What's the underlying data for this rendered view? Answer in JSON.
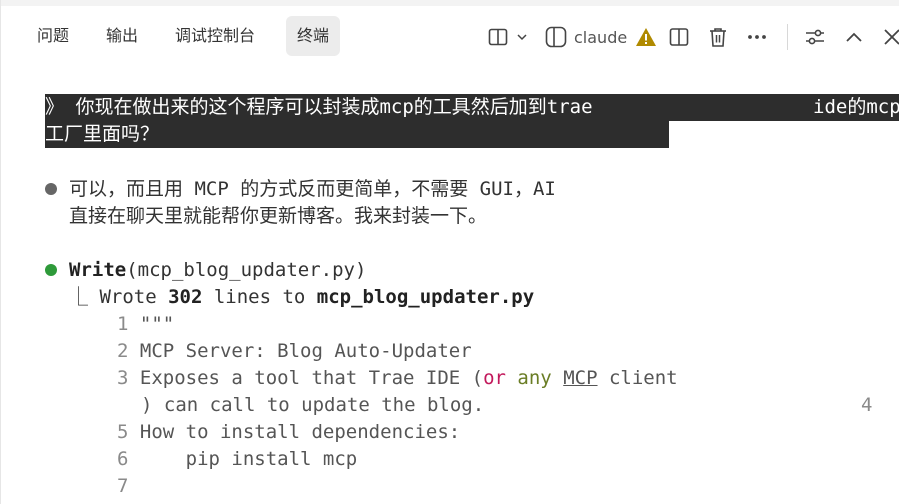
{
  "tabs": [
    {
      "label": "问题",
      "active": false
    },
    {
      "label": "输出",
      "active": false
    },
    {
      "label": "调试控制台",
      "active": false
    },
    {
      "label": "终端",
      "active": true
    }
  ],
  "toolbar": {
    "profile_label": "claude",
    "icons": [
      "split-layout-icon",
      "chevron-down-icon",
      "terminal-profile-icon",
      "warning-icon",
      "split-editor-icon",
      "trash-icon",
      "more-icon",
      "settings-sliders-icon",
      "chevron-up-icon",
      "close-icon"
    ],
    "warning_color": "#b08a00"
  },
  "terminal": {
    "prompt": {
      "marker": "》",
      "line1_a": "你现在做出来的这个程序可以封装成mcp的工具然后加到trae",
      "line1_b": "ide的mcp",
      "line2": "工厂里面吗？"
    },
    "reply": {
      "line1": "可以，而且用 MCP 的方式反而更简单，不需要 GUI，AI",
      "line2": "直接在聊天里就能帮你更新博客。我来封装一下。"
    },
    "tool_call": {
      "name": "Write",
      "arg": "(mcp_blog_updater.py)",
      "result_prefix": "⎿ Wrote ",
      "result_count": "302",
      "result_mid": " lines to ",
      "result_file": "mcp_blog_updater.py"
    },
    "code_lines": [
      {
        "num": "1",
        "text": "\"\"\""
      },
      {
        "num": "2",
        "text": "MCP Server: Blog Auto-Updater"
      },
      {
        "num": "3",
        "text_a": "Exposes a tool that Trae IDE (",
        "kw": "or",
        "sp": " ",
        "ident": "any",
        "sp2": " ",
        "ul": "MCP",
        "text_b": " client"
      },
      {
        "num": "",
        "text": ") can call to update the blog.",
        "trailing_num": "4"
      },
      {
        "num": "5",
        "text": "How to install dependencies:"
      },
      {
        "num": "6",
        "text": "    pip install mcp"
      },
      {
        "num": "7",
        "text": ""
      }
    ],
    "colors": {
      "success": "#2e9a3a",
      "prompt_bg": "#2d2d2d",
      "keyword": "#c2185b",
      "identifier": "#6a7d25"
    }
  }
}
